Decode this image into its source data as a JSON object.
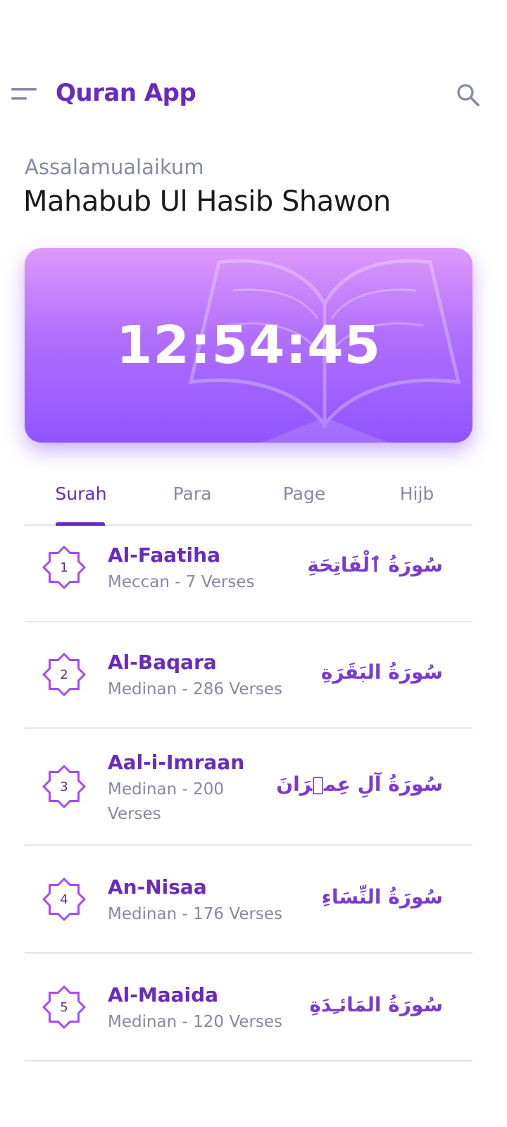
{
  "appbar": {
    "title": "Quran App",
    "menu_icon": "menu-icon",
    "search_icon": "search-icon"
  },
  "greeting": {
    "salutation": "Assalamualaikum",
    "user_name": "Mahabub Ul Hasib Shawon"
  },
  "clock_card": {
    "time": "12:54:45",
    "gradient": [
      "#DF98FA",
      "#9055FF"
    ]
  },
  "tabs": [
    {
      "label": "Surah",
      "active": true
    },
    {
      "label": "Para",
      "active": false
    },
    {
      "label": "Page",
      "active": false
    },
    {
      "label": "Hijb",
      "active": false
    }
  ],
  "surahs": [
    {
      "number": "1",
      "name": "Al-Faatiha",
      "meta": "Meccan - 7 Verses",
      "arabic": "سُورَةُ ٱلْفَاتِحَةِ"
    },
    {
      "number": "2",
      "name": "Al-Baqara",
      "meta": "Medinan - 286 Verses",
      "arabic": "سُورَةُ البَقَرَةِ"
    },
    {
      "number": "3",
      "name": "Aal-i-Imraan",
      "meta_line1": "Medinan - 200",
      "meta_line2": "Verses",
      "arabic": "سُورَةُ آلِ عِمۡرَانَ"
    },
    {
      "number": "4",
      "name": "An-Nisaa",
      "meta": "Medinan - 176 Verses",
      "arabic": "سُورَةُ النِّسَاءِ"
    },
    {
      "number": "5",
      "name": "Al-Maaida",
      "meta": "Medinan - 120 Verses",
      "arabic": "سُورَةُ المَائـِدَةِ"
    }
  ],
  "colors": {
    "primary": "#672CBC",
    "muted": "#8789A3",
    "divider": "#E3E3EA"
  }
}
